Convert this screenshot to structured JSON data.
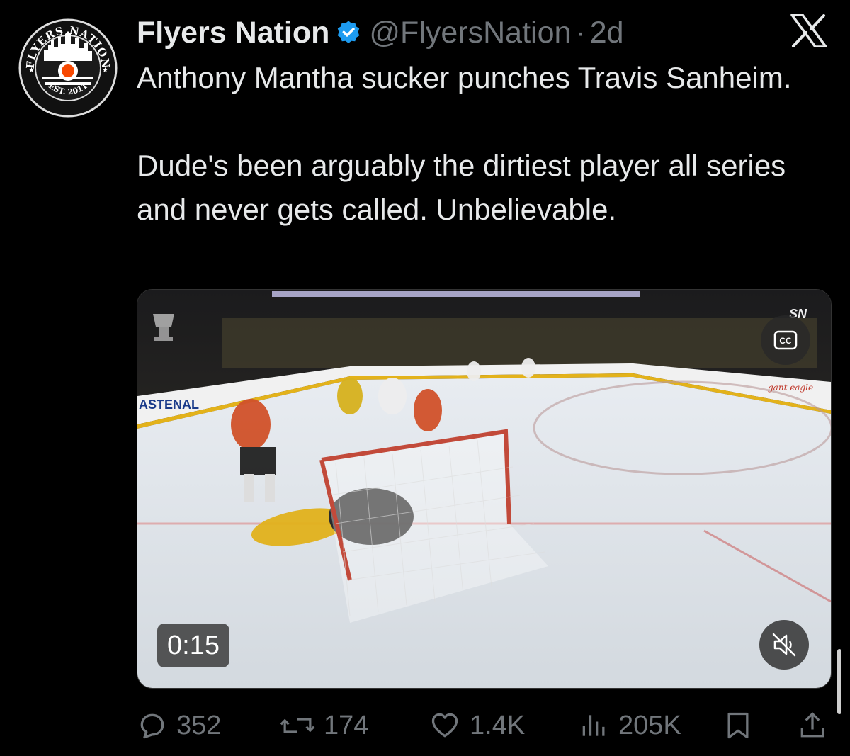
{
  "tweet": {
    "display_name": "Flyers Nation",
    "handle": "@FlyersNation",
    "separator": "·",
    "time": "2d",
    "text": "Anthony Mantha sucker punches Travis Sanheim.\n\nDude's been arguably the dirtiest player all series and never gets called. Unbelievable."
  },
  "avatar": {
    "ring_text_top": "FLYERS NATION",
    "ring_text_bottom": "EST. 2011",
    "brand_color": "#f74902"
  },
  "media": {
    "duration": "0:15",
    "cc_label": "CC",
    "broadcaster_logo": "SN",
    "board_sign": "ASTENAL",
    "board_sign_right": "gant eagle"
  },
  "actions": {
    "replies": "352",
    "reposts": "174",
    "likes": "1.4K",
    "views": "205K"
  },
  "icons": {
    "verified": "verified-badge-icon",
    "x": "x-logo-icon",
    "reply": "reply-icon",
    "repost": "repost-icon",
    "like": "heart-icon",
    "views": "views-icon",
    "bookmark": "bookmark-icon",
    "share": "share-icon",
    "mute": "mute-icon"
  },
  "colors": {
    "background": "#000000",
    "text": "#e7e9ea",
    "muted": "#71767b",
    "verified": "#1d9bf0"
  }
}
